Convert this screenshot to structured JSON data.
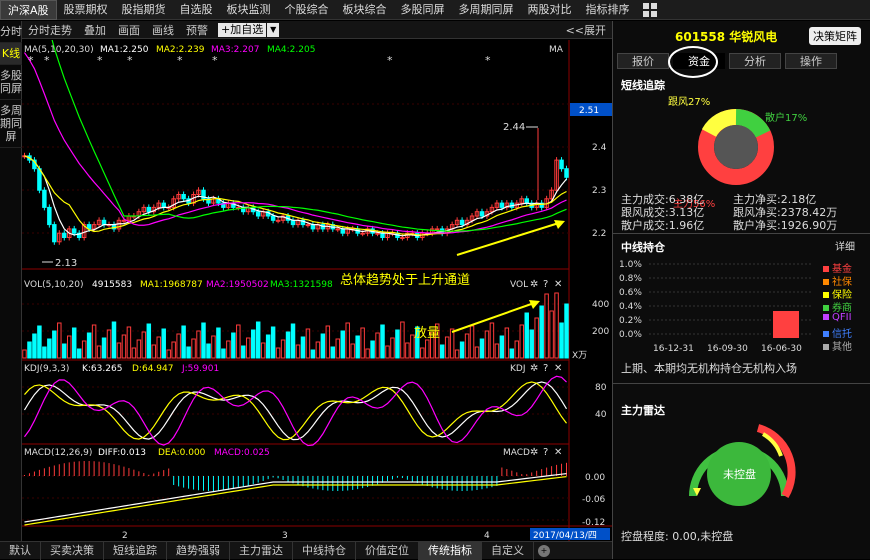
{
  "topbar": {
    "tabs": [
      "沪深A股",
      "股票期权",
      "股指期货",
      "自选股",
      "板块监测",
      "个股综合",
      "板块综合",
      "多股同屏",
      "多周期同屏",
      "两股对比",
      "指标排序"
    ]
  },
  "leftbar": {
    "items": [
      "分时",
      "K线",
      "多股同屏",
      "多周期同屏"
    ]
  },
  "toolbar": {
    "items": [
      "分时走势",
      "叠加",
      "画面",
      "画线",
      "预警"
    ],
    "add_label": "+加自选",
    "expand_label": "<<展开"
  },
  "main_chart": {
    "ma_legend": {
      "label": "MA(5,10,20,30)",
      "ma1": "MA1:2.250",
      "ma2": "MA2:2.239",
      "ma3": "MA3:2.207",
      "ma4": "MA4:2.205",
      "ma_tag": "MA"
    },
    "y_ticks": [
      "2.51",
      "2.4",
      "2.3",
      "2.2"
    ],
    "high_label": "2.44",
    "low_label": "2.13",
    "annotation_trend": "总体趋势处于上升通道",
    "annotation_volume": "放量"
  },
  "vol_panel": {
    "label": "VOL(5,10,20)",
    "value": "4915583",
    "ma1": "MA1:1968787",
    "ma2": "MA2:1950502",
    "ma3": "MA3:1321598",
    "tag": "VOL",
    "y_ticks": [
      "400",
      "200"
    ],
    "unit": "X万"
  },
  "kdj_panel": {
    "label": "KDJ(9,3,3)",
    "k": "K:63.265",
    "d": "D:64.947",
    "j": "J:59.901",
    "tag": "KDJ",
    "y_ticks": [
      "80",
      "40"
    ]
  },
  "macd_panel": {
    "label": "MACD(12,26,9)",
    "diff": "DIFF:0.013",
    "dea": "DEA:0.000",
    "macd": "MACD:0.025",
    "tag": "MACD",
    "y_ticks": [
      "0.00",
      "-0.06",
      "-0.12"
    ]
  },
  "x_axis": {
    "labels": [
      "2",
      "3",
      "4"
    ],
    "date_box": "2017/04/13/四"
  },
  "bottombar": {
    "tabs": [
      "默认",
      "买卖决策",
      "短线追踪",
      "趋势强弱",
      "主力雷达",
      "中线持仓",
      "价值定位",
      "传统指标",
      "自定义"
    ]
  },
  "right_panel": {
    "stock_title": "601558 华锐风电",
    "advice_button": "决策矩阵",
    "tabs": [
      "报价",
      "资金",
      "分析",
      "操作"
    ],
    "short_track": {
      "title": "短线追踪",
      "labels": {
        "follow": "跟风27%",
        "retail": "散户17%",
        "main": "主力56%"
      },
      "rows": [
        [
          "主力成交:6.38亿",
          "主力净买:2.18亿"
        ],
        [
          "跟风成交:3.13亿",
          "跟风净买:2378.42万"
        ],
        [
          "散户成交:1.96亿",
          "散户净买:1926.90万"
        ]
      ]
    },
    "mid_hold": {
      "title": "中线持仓",
      "detail": "详细",
      "y_ticks": [
        "1.0%",
        "0.8%",
        "0.6%",
        "0.4%",
        "0.2%",
        "0.0%"
      ],
      "x_ticks": [
        "16-12-31",
        "16-09-30",
        "16-06-30"
      ],
      "legend": [
        "基金",
        "社保",
        "保险",
        "券商",
        "QFII",
        "信托",
        "其他"
      ],
      "note": "上期、本期均无机构持仓无机构入场"
    },
    "radar": {
      "title": "主力雷达",
      "center": "未控盘",
      "footer": "控盘程度: 0.00,未控盘"
    }
  },
  "colors": {
    "up": "#ff3b3b",
    "down": "#00ffff",
    "ma1": "#ffffff",
    "ma2": "#ffff00",
    "ma3": "#ff00ff",
    "ma4": "#00ff00",
    "main": "#ff4040",
    "follow": "#ffff40",
    "retail": "#40d040"
  }
}
